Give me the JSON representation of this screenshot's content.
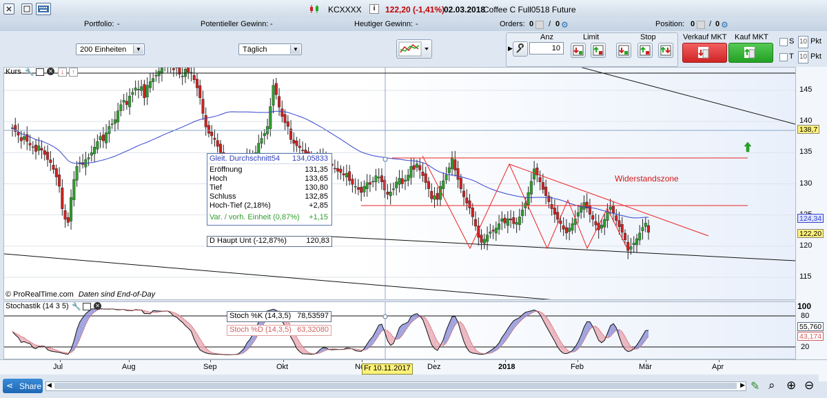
{
  "titlebar": {
    "symbol": "KCXXXX",
    "price_change": "122,20 (-1,41%)",
    "date": "02.03.2018",
    "instrument": "Coffee C Full0518 Future"
  },
  "stats": {
    "portfolio_label": "Portfolio:",
    "portfolio_value": "-",
    "potential_label": "Potentieller Gewinn:",
    "potential_value": "-",
    "today_label": "Heutiger Gewinn:",
    "today_value": "-",
    "orders_label": "Orders:",
    "orders_value": "0",
    "orders_sep": "/",
    "orders_value2": "0",
    "position_label": "Position:",
    "position_value": "0",
    "position_sep": "/",
    "position_value2": "0"
  },
  "toolbar": {
    "units_select": "200 Einheiten",
    "period_select": "Täglich",
    "anz_label": "Anz",
    "anz_value": "10",
    "limit_label": "Limit",
    "stop_label": "Stop",
    "sell_label": "Verkauf MKT",
    "buy_label": "Kauf MKT",
    "s_label": "S",
    "t_label": "T",
    "s_value": "10",
    "t_value": "10",
    "pkt_label": "Pkt",
    "pkt_label2": "Pkt"
  },
  "kurs_panel": {
    "label": "Kurs",
    "copyright": "© ProRealTime.com",
    "delay_note": "Daten sind End-of-Day",
    "zone_label": "Widerstandszone",
    "ma_label": "Gleit. Durchschnitt54",
    "ma_value": "134,05833",
    "rows": [
      {
        "label": "Eröffnung",
        "value": "131,35"
      },
      {
        "label": "Hoch",
        "value": "133,65"
      },
      {
        "label": "Tief",
        "value": "130,80"
      },
      {
        "label": "Schluss",
        "value": "132,85"
      },
      {
        "label": "Hoch-Tief (2,18%)",
        "value": "+2,85"
      }
    ],
    "var_label": "Var. / vorh. Einheit (0,87%)",
    "var_value": "+1,15",
    "trend_label": "D Haupt Unt (-12,87%)",
    "trend_value": "120,83"
  },
  "stoch_panel": {
    "label": "Stochastik (14 3 5)",
    "k_label": "Stoch %K (14,3,5)",
    "k_value": "78,53597",
    "d_label": "Stoch %D (14,3,5)",
    "d_value": "63,32080"
  },
  "axis_tags": {
    "price_hline": "138,7",
    "ma_last": "124,34",
    "last_price": "122,20",
    "k_last": "55,760",
    "d_last": "43,174",
    "cursor_date": "Fr 10.11.2017"
  },
  "bottom": {
    "share_label": "Share"
  },
  "colors": {
    "up": "#2e9e2e",
    "down": "#cc2222",
    "ma": "#3344cc",
    "resistance": "#ee2222",
    "sell_btn": "#e03030",
    "buy_btn": "#2fae2f",
    "price_tag": "#fff27a"
  },
  "chart_data": [
    {
      "type": "candlestick",
      "title": "Kurs",
      "y_ticks": [
        115,
        120,
        125,
        130,
        135,
        140,
        145
      ],
      "ylim": [
        111,
        153
      ],
      "x_ticks": [
        "Jul",
        "Aug",
        "Sep",
        "Okt",
        "Nov",
        "Dez",
        "2018",
        "Feb",
        "Mär",
        "Apr"
      ],
      "grid": "horizontal",
      "series": [
        {
          "name": "Gleit. Durchschnitt54",
          "last_value": 124.34
        }
      ],
      "closes": [
        139.0,
        138.4,
        137.8,
        136.9,
        137.6,
        136.8,
        136.2,
        135.9,
        135.2,
        136.1,
        135.4,
        134.7,
        133.9,
        133.4,
        132.3,
        131.1,
        129.6,
        126.0,
        124.3,
        123.8,
        127.8,
        130.7,
        132.8,
        133.4,
        133.1,
        133.9,
        134.2,
        135.0,
        135.9,
        136.8,
        137.6,
        136.9,
        138.2,
        139.2,
        139.6,
        140.3,
        141.7,
        142.7,
        143.4,
        142.7,
        144.1,
        144.7,
        145.4,
        145.2,
        145.6,
        143.8,
        145.8,
        146.4,
        146.9,
        147.4,
        148.1,
        148.6,
        148.9,
        149.6,
        148.8,
        148.3,
        149.1,
        147.6,
        147.3,
        148.4,
        147.9,
        147.8,
        146.7,
        145.4,
        143.8,
        141.3,
        139.1,
        138.1,
        137.7,
        137.1,
        136.0,
        135.0,
        133.8,
        132.8,
        132.4,
        132.6,
        132.1,
        132.3,
        133.6,
        133.2,
        134.3,
        134.3,
        134.7,
        135.0,
        136.5,
        137.3,
        138.1,
        139.2,
        142.4,
        145.8,
        144.3,
        142.3,
        140.8,
        139.8,
        139.2,
        137.1,
        136.5,
        136.1,
        135.8,
        135.3,
        134.8,
        134.2,
        133.4,
        133.5,
        134.2,
        134.7,
        134.0,
        133.6,
        133.2,
        132.9,
        132.4,
        132.0,
        131.8,
        131.4,
        131.7,
        130.5,
        129.9,
        129.6,
        129.1,
        128.6,
        129.6,
        130.2,
        129.9,
        130.4,
        131.3,
        131.1,
        130.3,
        129.0,
        128.3,
        128.7,
        129.2,
        130.3,
        130.9,
        130.0,
        130.6,
        131.4,
        132.8,
        132.3,
        133.2,
        132.2,
        131.3,
        130.2,
        129.2,
        127.6,
        128.1,
        127.5,
        129.6,
        130.5,
        131.4,
        132.6,
        134.2,
        132.2,
        130.7,
        129.2,
        127.9,
        126.9,
        126.1,
        124.7,
        123.2,
        121.4,
        120.6,
        121.1,
        121.8,
        122.3,
        122.4,
        122.9,
        123.6,
        124.4,
        123.7,
        124.4,
        124.2,
        123.6,
        123.8,
        124.7,
        125.8,
        126.9,
        128.6,
        130.4,
        132.4,
        131.4,
        130.3,
        129.1,
        128.1,
        127.1,
        126.0,
        125.1,
        124.3,
        123.6,
        122.7,
        122.1,
        122.9,
        123.6,
        124.4,
        125.4,
        126.3,
        127.0,
        126.1,
        125.1,
        124.3,
        123.4,
        122.6,
        123.4,
        124.3,
        125.5,
        126.3,
        125.3,
        124.1,
        123.1,
        122.2,
        121.0,
        119.3,
        119.9,
        120.5,
        121.2,
        122.1,
        123.0,
        123.7,
        122.2
      ]
    },
    {
      "type": "line",
      "title": "Stochastik (14 3 5)",
      "y_ticks": [
        20,
        40,
        60,
        80,
        100
      ],
      "ylim": [
        0,
        100
      ],
      "series": [
        {
          "name": "Stoch %K (14,3,5)",
          "last_value": 55.76
        },
        {
          "name": "Stoch %D (14,3,5)",
          "last_value": 43.174
        }
      ]
    }
  ]
}
